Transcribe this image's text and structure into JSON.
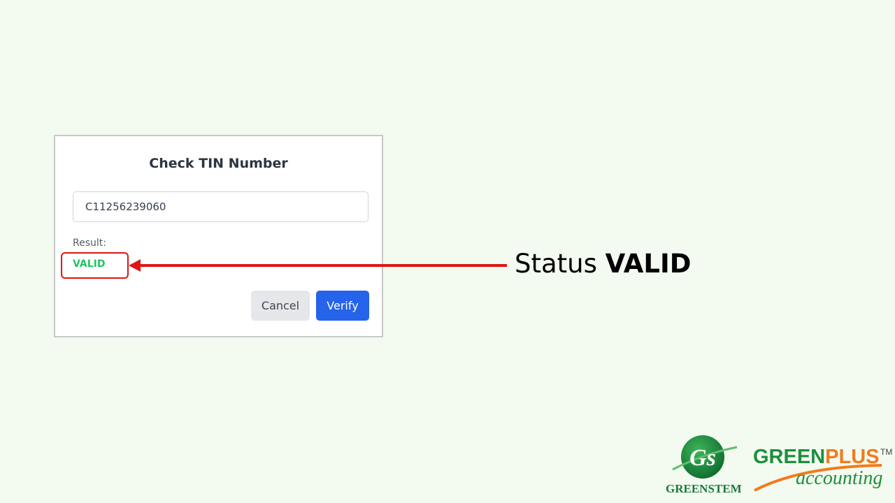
{
  "dialog": {
    "title": "Check TIN Number",
    "tin_value": "C11256239060",
    "result_label": "Result:",
    "status_value": "VALID",
    "cancel_label": "Cancel",
    "verify_label": "Verify"
  },
  "annotation": {
    "prefix": "Status",
    "emphasis": "VALID"
  },
  "logos": {
    "greenstem_monogram": "Gs",
    "greenstem_name": "GREENSTEM",
    "greenplus_green": "GREEN",
    "greenplus_orange": "PLUS",
    "greenplus_tm": "TM",
    "greenplus_sub": "accounting"
  },
  "colors": {
    "valid_status": "#22c55e",
    "highlight_red": "#e11414",
    "verify_button": "#2563eb",
    "cancel_button": "#e5e7eb",
    "brand_green": "#1d8f3c",
    "brand_orange": "#f27b1d"
  }
}
